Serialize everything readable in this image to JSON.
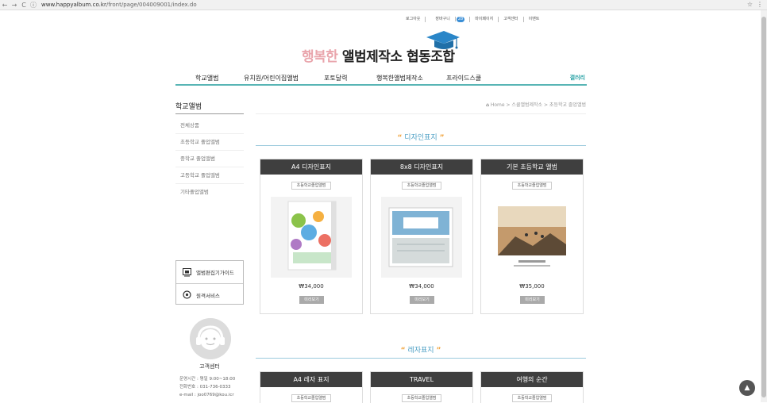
{
  "browser": {
    "url_host": "www.happyalbum.co.kr",
    "url_path": "/front/page/004009001/index.do"
  },
  "topnav": {
    "logout": "로그아웃",
    "cart": "장바구니",
    "cart_count": "28",
    "mypage": "마이페이지",
    "support": "고객센터",
    "event": "이벤트"
  },
  "logo": {
    "part1": "행복한",
    "part2": " 앨범제작소 협동조합"
  },
  "mainnav": {
    "items": [
      "학교앨범",
      "유치원/어린이집앨범",
      "포토달력",
      "행복한앨범제작소",
      "프라이드스쿨"
    ],
    "gallery": "갤러리"
  },
  "sidebar": {
    "title": "학교앨범",
    "items": [
      "전체상품",
      "초등학교 졸업앨범",
      "중학교 졸업앨범",
      "고등학교 졸업앨범",
      "기타졸업앨범"
    ]
  },
  "guide": {
    "editor": "앨범편집기가이드",
    "remote": "원격서비스"
  },
  "customer_center": {
    "title": "고객센터",
    "hours": "운영시간 : 평일 9:00~18:00",
    "phone": "전화번호 : 031-736-0333",
    "email": "e-mail : joo0769@kou.icr"
  },
  "breadcrumb": {
    "home": "Home",
    "path": " > 스쿨앨범제작소 > 초등학교 졸업앨범"
  },
  "sections": [
    {
      "title": "디자인표지",
      "products": [
        {
          "name": "A4 디자인표지",
          "tag": "초등학교졸업앨범",
          "price": "₩34,000",
          "view": "미리보기"
        },
        {
          "name": "8x8 디자인표지",
          "tag": "초등학교졸업앨범",
          "price": "₩34,000",
          "view": "미리보기"
        },
        {
          "name": "기본 초등학교 앨범",
          "tag": "초등학교졸업앨범",
          "price": "₩35,000",
          "view": "미리보기"
        }
      ]
    },
    {
      "title": "레자표지",
      "products": [
        {
          "name": "A4 레자 표지",
          "tag": "초등학교졸업앨범"
        },
        {
          "name": "TRAVEL",
          "tag": "초등학교졸업앨범"
        },
        {
          "name": "여행의 순간",
          "tag": "초등학교졸업앨범"
        }
      ]
    }
  ],
  "colors": {
    "teal": "#58b5b5",
    "section_blue": "#4ea0c5",
    "quote_orange": "#f0a23a",
    "card_head": "#3f3f3f"
  }
}
